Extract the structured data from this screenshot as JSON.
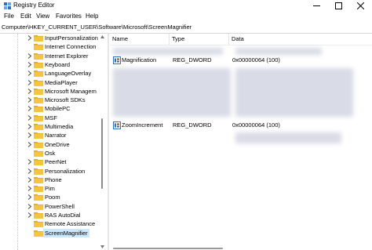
{
  "window": {
    "title": "Registry Editor",
    "controls": {
      "minimize": "minimize-icon",
      "maximize": "maximize-icon",
      "close": "close-icon"
    }
  },
  "menu": [
    "File",
    "Edit",
    "View",
    "Favorites",
    "Help"
  ],
  "address": "Computer\\HKEY_CURRENT_USER\\Software\\Microsoft\\ScreenMagnifier",
  "tree": {
    "items": [
      {
        "label": "InputPersonalization",
        "expandable": true
      },
      {
        "label": "Internet Connection",
        "expandable": false
      },
      {
        "label": "Internet Explorer",
        "expandable": true
      },
      {
        "label": "Keyboard",
        "expandable": true
      },
      {
        "label": "LanguageOverlay",
        "expandable": true
      },
      {
        "label": "MediaPlayer",
        "expandable": true
      },
      {
        "label": "Microsoft Managem",
        "expandable": true
      },
      {
        "label": "Microsoft SDKs",
        "expandable": true
      },
      {
        "label": "MobilePC",
        "expandable": true
      },
      {
        "label": "MSF",
        "expandable": true
      },
      {
        "label": "Multimedia",
        "expandable": true
      },
      {
        "label": "Narrator",
        "expandable": true
      },
      {
        "label": "OneDrive",
        "expandable": true
      },
      {
        "label": "Osk",
        "expandable": false
      },
      {
        "label": "PeerNet",
        "expandable": true
      },
      {
        "label": "Personalization",
        "expandable": true
      },
      {
        "label": "Phone",
        "expandable": true
      },
      {
        "label": "Pim",
        "expandable": true
      },
      {
        "label": "Poom",
        "expandable": true
      },
      {
        "label": "PowerShell",
        "expandable": true
      },
      {
        "label": "RAS AutoDial",
        "expandable": true
      },
      {
        "label": "Remote Assistance",
        "expandable": false
      },
      {
        "label": "ScreenMagnifier",
        "expandable": false,
        "selected": true
      }
    ]
  },
  "values_panel": {
    "columns": {
      "name": "Name",
      "type": "Type",
      "data": "Data"
    },
    "rows": [
      {
        "name": "Magnification",
        "type": "REG_DWORD",
        "data": "0x00000064 (100)"
      },
      {
        "name": "ZoomIncrement",
        "type": "REG_DWORD",
        "data": "0x00000064 (100)"
      }
    ]
  },
  "colors": {
    "selection": "#cce8ff",
    "folder": "#f5c542",
    "folder_dark": "#e0a820",
    "value_icon": "#2f6fbf"
  }
}
